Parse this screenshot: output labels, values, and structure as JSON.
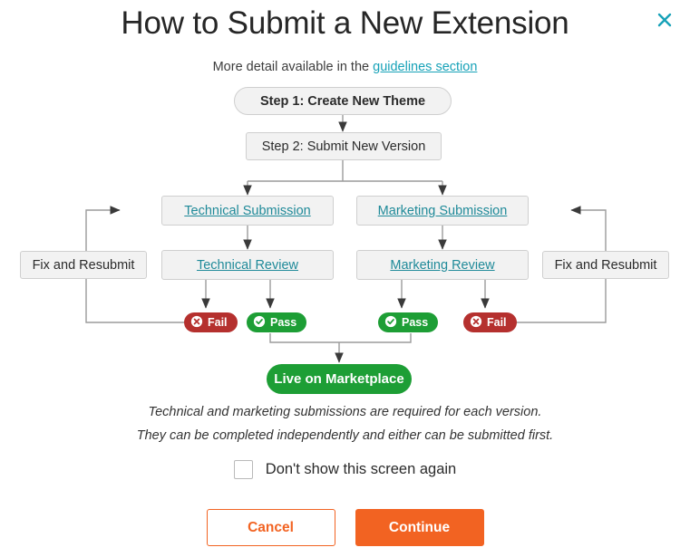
{
  "dialog": {
    "title": "How to Submit a New Extension",
    "close_icon": "close-icon",
    "subtitle_prefix": "More detail available in the ",
    "subtitle_link": "guidelines section"
  },
  "colors": {
    "accent_orange": "#f26322",
    "link_teal": "#1f8a99",
    "close_teal": "#17a2b8",
    "pass_green": "#1d9e35",
    "fail_red": "#b5302e",
    "node_fill": "#f2f2f2",
    "node_border": "#cfcfcf",
    "connector": "#9b9b9b"
  },
  "flow": {
    "step1": "Step 1: Create New Theme",
    "step2": "Step 2: Submit New Version",
    "technical_submission": "Technical Submission",
    "marketing_submission": "Marketing Submission",
    "technical_review": "Technical Review",
    "marketing_review": "Marketing Review",
    "fix_left": "Fix and Resubmit",
    "fix_right": "Fix and Resubmit",
    "fail_left": "Fail",
    "pass_left": "Pass",
    "pass_right": "Pass",
    "fail_right": "Fail",
    "live": "Live on Marketplace"
  },
  "notes": {
    "line1": "Technical and marketing submissions are required for each version.",
    "line2": "They can be completed independently and either can be submitted first."
  },
  "checkbox": {
    "label": "Don't show this screen again",
    "checked": false
  },
  "buttons": {
    "cancel": "Cancel",
    "continue": "Continue"
  }
}
